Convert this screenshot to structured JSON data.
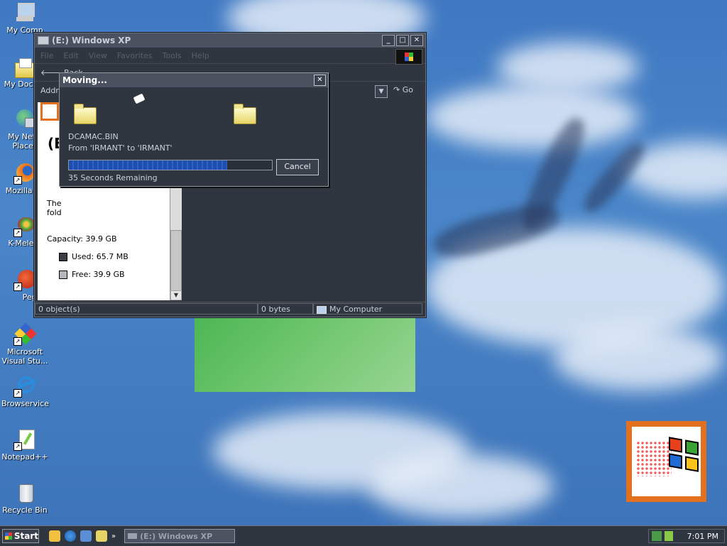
{
  "desktop": {
    "icons": [
      {
        "label": "My Computer",
        "icon": "computer-icon"
      },
      {
        "label": "My Documents",
        "icon": "folder-documents-icon"
      },
      {
        "label": "My Network Places",
        "icon": "network-icon"
      },
      {
        "label": "Mozilla Firefox",
        "icon": "firefox-icon"
      },
      {
        "label": "K-Meleon",
        "icon": "kmeleon-icon"
      },
      {
        "label": "Pegasus",
        "icon": "pegasus-icon"
      },
      {
        "label": "Microsoft Visual Stu...",
        "icon": "visual-studio-icon"
      },
      {
        "label": "Browservice",
        "icon": "ie-icon"
      },
      {
        "label": "Notepad++",
        "icon": "notepadpp-icon"
      },
      {
        "label": "Recycle Bin",
        "icon": "recycle-bin-icon"
      }
    ],
    "visible_labels": {
      "my_computer": "My Comp",
      "my_documents": "My Docum",
      "network_1": "My Netw",
      "network_2": "Places",
      "firefox": "Mozilla Fir",
      "kmeleon": "K-Meleor",
      "pegasus": "Pego",
      "vs_1": "Microsoft",
      "vs_2": "Visual Stu...",
      "browservice": "Browservice",
      "notepadpp": "Notepad++",
      "recycle": "Recycle Bin"
    }
  },
  "explorer": {
    "title": "(E:) Windows XP",
    "menu": [
      "File",
      "Edit",
      "View",
      "Favorites",
      "Tools",
      "Help"
    ],
    "toolbar": {
      "back_label": "Back"
    },
    "address_label": "Addre",
    "go_label": "Go",
    "left_pane": {
      "drive_heading": "(E",
      "text_line1": "The",
      "text_line2": "fold",
      "capacity": "Capacity: 39.9 GB",
      "used": "Used: 65.7 MB",
      "free": "Free: 39.9 GB",
      "used_color": "#3a3f46",
      "free_color": "#b4b8bd"
    },
    "status": {
      "objects": "0 object(s)",
      "size": "0 bytes",
      "location": "My Computer"
    }
  },
  "dialog": {
    "title": "Moving...",
    "filename": "DCAMAC.BIN",
    "from_to": "From 'IRMANT' to 'IRMANT'",
    "remaining": "35 Seconds Remaining",
    "cancel_label": "Cancel",
    "progress_fraction": 0.78
  },
  "taskbar": {
    "start_label": "Start",
    "task_label": "(E:) Windows XP",
    "clock": "7:01 PM"
  },
  "colors": {
    "accent_blue": "#0a246a",
    "window_bg": "#2f3640",
    "titlebar": "#4a5260",
    "logo_orange": "#e2701f"
  }
}
